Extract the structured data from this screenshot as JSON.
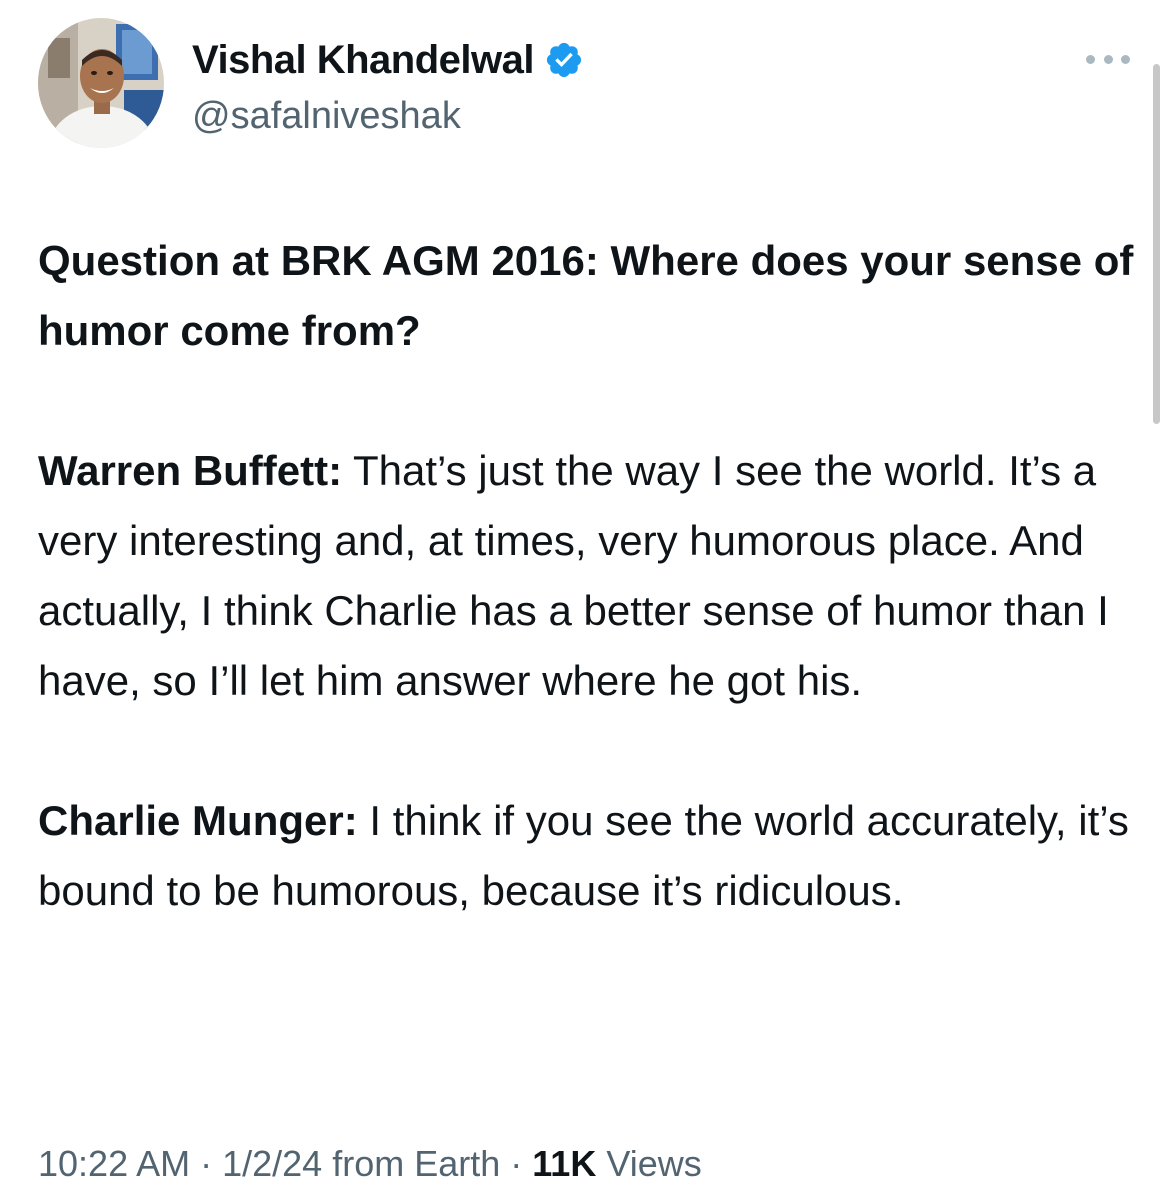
{
  "author": {
    "display_name": "Vishal Khandelwal",
    "handle": "@safalniveshak",
    "verified": true,
    "badge_color": "#1d9bf0"
  },
  "tweet": {
    "question": "Question at BRK AGM 2016: Where does your sense of humor come from?",
    "buffett_speaker": "Warren Buffett:",
    "buffett_text": " That’s just the way I see the world. It’s a very interesting and, at times, very humorous place. And actually, I think Charlie has a better sense of humor than I have, so I’ll let him answer where he got his.",
    "munger_speaker": "Charlie Munger:",
    "munger_text": " I think if you see the world accurately, it’s bound to be humorous, because it’s ridiculous."
  },
  "meta": {
    "time": "10:22 AM",
    "sep1": " · ",
    "date": "1/2/24",
    "location": " from Earth",
    "sep2": " · ",
    "views_count": "11K",
    "views_label": " Views"
  },
  "icons": {
    "more": "more-options-icon",
    "verified": "verified-badge-icon"
  }
}
